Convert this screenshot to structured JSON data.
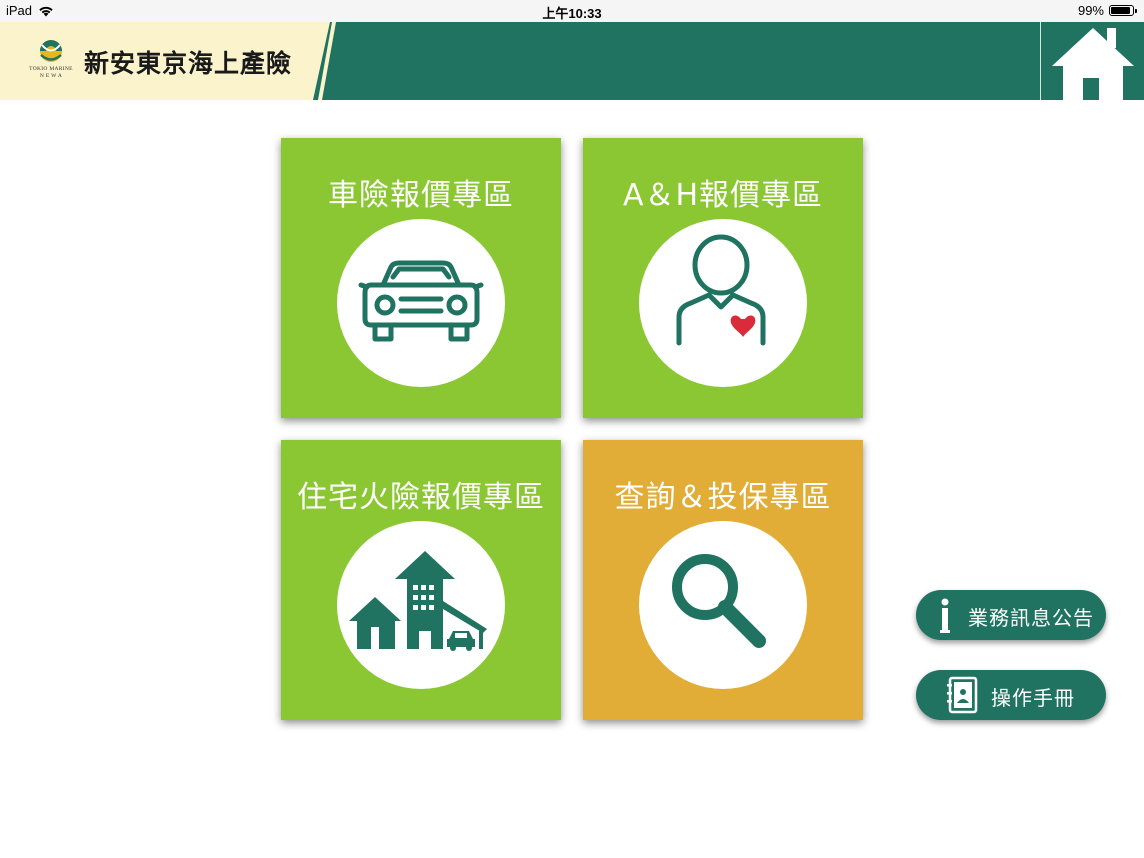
{
  "status_bar": {
    "device": "iPad",
    "time": "上午10:33",
    "battery": "99%",
    "battery_level": 0.99
  },
  "header": {
    "logo_text_line1": "TOKIO MARINE",
    "logo_text_line2": "N E W A",
    "brand_name": "新安東京海上產險",
    "home_icon": "home-icon"
  },
  "tiles": [
    {
      "title": "車險報價專區",
      "icon": "car-icon",
      "color": "#8bc733"
    },
    {
      "title": "A＆H報價專區",
      "icon": "person-heart-icon",
      "color": "#8bc733"
    },
    {
      "title": "住宅火險報價專區",
      "icon": "houses-icon",
      "color": "#8bc733"
    },
    {
      "title": "查詢＆投保專區",
      "icon": "search-icon",
      "color": "#e1ad36"
    }
  ],
  "side_buttons": [
    {
      "label": "業務訊息公告",
      "icon": "info-icon"
    },
    {
      "label": "操作手冊",
      "icon": "manual-icon"
    }
  ],
  "colors": {
    "primary": "#1f7360",
    "green": "#8bc733",
    "orange": "#e1ad36",
    "cream": "#fbf3cc",
    "heart": "#d92b3a"
  }
}
